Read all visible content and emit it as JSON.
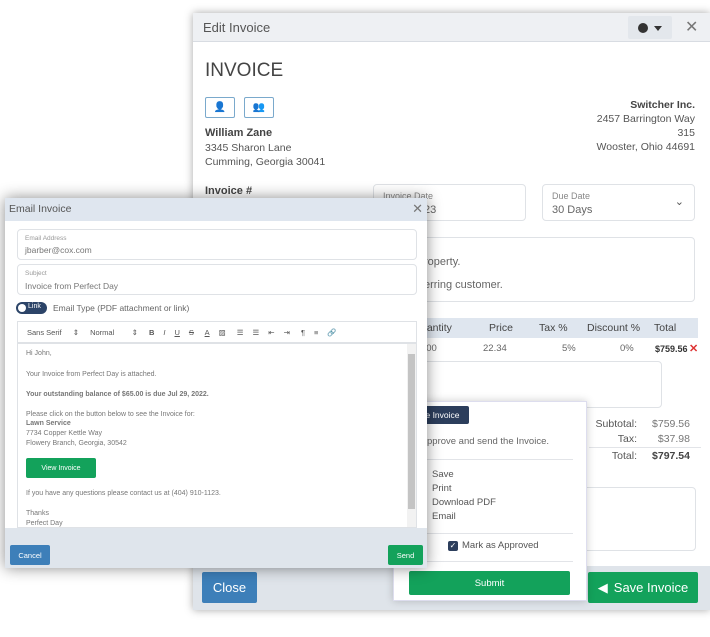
{
  "edit_invoice": {
    "title": "Edit Invoice",
    "heading": "INVOICE",
    "customer": {
      "name": "William Zane",
      "line1": "3345 Sharon Lane",
      "line2": "Cumming, Georgia 30041"
    },
    "company": {
      "name": "Switcher Inc.",
      "line1": "2457 Barrington Way",
      "line2": "315",
      "line3": "Wooster, Ohio 44691"
    },
    "invoice_number_label": "Invoice #",
    "invoice_date_label": "Invoice Date",
    "invoice_date_value": "23",
    "due_date_label": "Due Date",
    "due_date_value": "30 Days",
    "notes_line1": "roperty.",
    "notes_line2": "erring customer.",
    "table": {
      "headers": [
        "uantity",
        "Price",
        "Tax %",
        "Discount %",
        "Total"
      ],
      "row": {
        "quantity": "34.00",
        "price": "22.34",
        "tax": "5%",
        "discount": "0%",
        "total": "$759.56"
      }
    },
    "subtotal_label": "Subtotal:",
    "subtotal": "$759.56",
    "tax_label": "Tax:",
    "tax": "$37.98",
    "total_label": "Total:",
    "total": "$797.54",
    "close_label": "Close",
    "save_label": "Save Invoice",
    "accent_green": "#13a25b",
    "accent_blue": "#3d7fb9"
  },
  "popup": {
    "badge": "e Invoice",
    "description": "pprove and send the Invoice.",
    "options": [
      "Save",
      "Print",
      "Download PDF",
      "Email"
    ],
    "approve_label": "Mark as Approved",
    "approve_checked": true,
    "submit_label": "Submit"
  },
  "email": {
    "title": "Email Invoice",
    "address_label": "Email Address",
    "address_value": "jbarber@cox.com",
    "subject_label": "Subject",
    "subject_value": "Invoice from Perfect Day",
    "toggle_label": "Link",
    "type_label": "Email Type (PDF attachment or link)",
    "toolbar": {
      "font": "Sans Serif",
      "size": "Normal"
    },
    "body": {
      "greeting": "Hi John,",
      "attached": "Your Invoice from Perfect Day is attached.",
      "balance": "Your outstanding balance of $65.00 is due Jul 29, 2022.",
      "click": "Please click on the button below to see the Invoice for:",
      "service": "Lawn Service",
      "addr1": "7734 Copper Kettle Way",
      "addr2": "Flowery Branch, Georgia, 30542",
      "view_button": "View Invoice",
      "contact": "If you have any questions please contact us at (404) 910-1123.",
      "thanks": "Thanks",
      "sign": "Perfect Day"
    },
    "cancel_label": "Cancel",
    "send_label": "Send"
  }
}
